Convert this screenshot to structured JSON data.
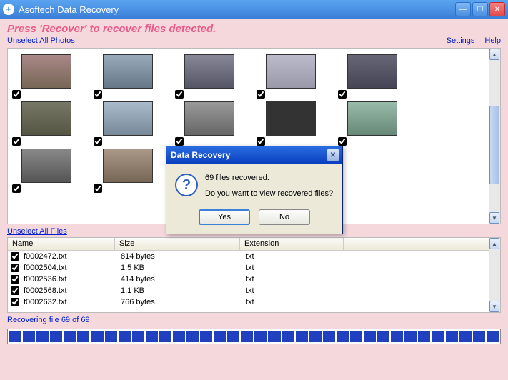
{
  "window": {
    "title": "Asoftech Data Recovery"
  },
  "instruction": "Press 'Recover' to recover files detected.",
  "links": {
    "unselect_photos": "Unselect All Photos",
    "unselect_files": "Unselect All Files",
    "settings": "Settings",
    "help": "Help"
  },
  "files": {
    "headers": {
      "name": "Name",
      "size": "Size",
      "ext": "Extension"
    },
    "rows": [
      {
        "name": "f0002472.txt",
        "size": "814 bytes",
        "ext": "txt"
      },
      {
        "name": "f0002504.txt",
        "size": "1.5 KB",
        "ext": "txt"
      },
      {
        "name": "f0002536.txt",
        "size": "414 bytes",
        "ext": "txt"
      },
      {
        "name": "f0002568.txt",
        "size": "1.1 KB",
        "ext": "txt"
      },
      {
        "name": "f0002632.txt",
        "size": "766 bytes",
        "ext": "txt"
      }
    ]
  },
  "status": "Recovering file 69 of 69",
  "dialog": {
    "title": "Data Recovery",
    "msg1": "69 files recovered.",
    "msg2": "Do you want to view recovered files?",
    "yes": "Yes",
    "no": "No"
  }
}
